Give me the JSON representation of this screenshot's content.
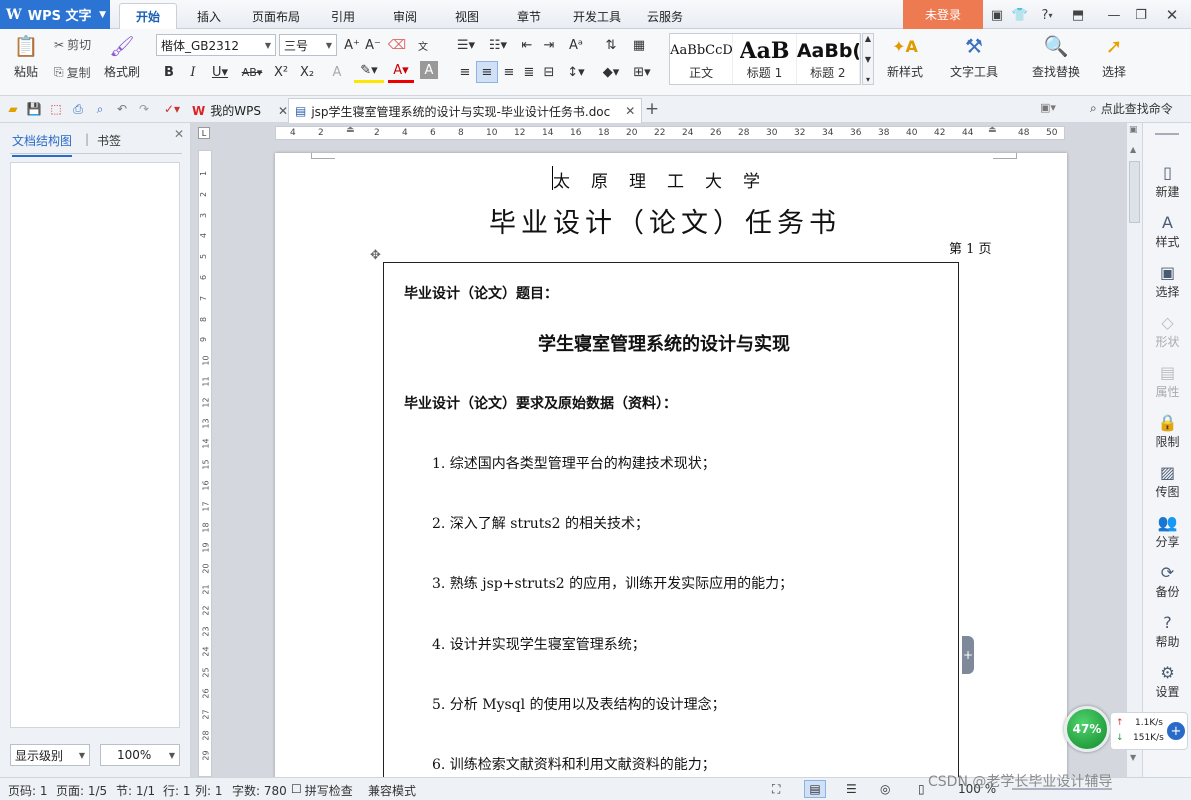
{
  "app": {
    "name": "WPS 文字"
  },
  "menu": {
    "tabs": [
      "开始",
      "插入",
      "页面布局",
      "引用",
      "审阅",
      "视图",
      "章节",
      "开发工具",
      "云服务"
    ]
  },
  "login": "未登录",
  "ribbon": {
    "paste": "粘贴",
    "cut": "剪切",
    "copy": "复制",
    "format_painter": "格式刷",
    "font_name": "楷体_GB2312",
    "font_size": "三号",
    "styles": [
      {
        "sample": "AaBbCcD",
        "label": "正文"
      },
      {
        "sample": "AaB",
        "label": "标题 1"
      },
      {
        "sample": "AaBb(",
        "label": "标题 2"
      }
    ],
    "new_style": "新样式",
    "text_tools": "文字工具",
    "find_replace": "查找替换",
    "select": "选择"
  },
  "docbar": {
    "tab1": "我的WPS",
    "tab2": "jsp学生寝室管理系统的设计与实现-毕业设计任务书.doc",
    "search": "点此查找命令"
  },
  "leftpanel": {
    "tab1": "文档结构图",
    "tab2": "书签",
    "level": "显示级别",
    "zoom": "100%"
  },
  "ruler": {
    "top": [
      "4",
      "2",
      "",
      "2",
      "4",
      "6",
      "8",
      "10",
      "12",
      "14",
      "16",
      "18",
      "20",
      "22",
      "24",
      "26",
      "28",
      "30",
      "32",
      "34",
      "36",
      "38",
      "40",
      "42",
      "44",
      "",
      "48",
      "50"
    ],
    "left": [
      "1",
      "2",
      "3",
      "4",
      "5",
      "6",
      "7",
      "8",
      "9",
      "10",
      "11",
      "12",
      "13",
      "14",
      "15",
      "16",
      "17",
      "18",
      "19",
      "20",
      "21",
      "22",
      "23",
      "24",
      "25",
      "26",
      "27",
      "28",
      "29"
    ]
  },
  "doc": {
    "university": "太　原　理　工　大　学",
    "title": "毕业设计（论文）任务书",
    "page_no": "第 1 页",
    "topic_label": "毕业设计（论文）题目：",
    "topic": "学生寝室管理系统的设计与实现",
    "req_label": "毕业设计（论文）要求及原始数据（资料）：",
    "items": [
      "1. 综述国内各类型管理平台的构建技术现状；",
      "2. 深入了解 struts2 的相关技术；",
      "3. 熟练 jsp+struts2 的应用，训练开发实际应用的能力；",
      "4. 设计并实现学生寝室管理系统；",
      "5. 分析 Mysql 的使用以及表结构的设计理念；",
      "6. 训练检索文献资料和利用文献资料的能力；"
    ]
  },
  "rightpanel": [
    {
      "icon": "new-icon",
      "label": "新建",
      "on": true
    },
    {
      "icon": "style-icon",
      "label": "样式",
      "on": true
    },
    {
      "icon": "select-icon",
      "label": "选择",
      "on": true
    },
    {
      "icon": "shape-icon",
      "label": "形状",
      "on": false
    },
    {
      "icon": "props-icon",
      "label": "属性",
      "on": false
    },
    {
      "icon": "limit-icon",
      "label": "限制",
      "on": true
    },
    {
      "icon": "send-icon",
      "label": "传图",
      "on": true
    },
    {
      "icon": "share-icon",
      "label": "分享",
      "on": true
    },
    {
      "icon": "backup-icon",
      "label": "备份",
      "on": true
    },
    {
      "icon": "help-icon",
      "label": "帮助",
      "on": true
    },
    {
      "icon": "gear-icon",
      "label": "设置",
      "on": true
    }
  ],
  "net": {
    "percent": "47%",
    "up": "1.1K/s",
    "down": "151K/s"
  },
  "status": {
    "page": "页码: 1",
    "pages": "页面: 1/5",
    "section": "节: 1/1",
    "row": "行: 1",
    "col": "列: 1",
    "words": "字数: 780",
    "spell": "拼写检查",
    "compat": "兼容模式",
    "zoom": "100 %"
  },
  "watermark": "CSDN @老学长毕业设计辅导"
}
